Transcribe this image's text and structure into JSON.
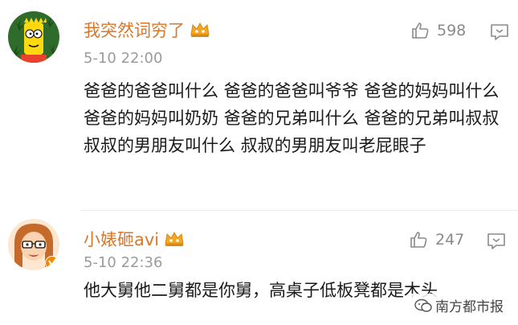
{
  "comments": [
    {
      "username": "我突然词穷了",
      "timestamp": "5-10 22:00",
      "likes": "598",
      "text": "爸爸的爸爸叫什么 爸爸的爸爸叫爷爷 爸爸的妈妈叫什么 爸爸的妈妈叫奶奶 爸爸的兄弟叫什么 爸爸的兄弟叫叔叔 叔叔的男朋友叫什么 叔叔的男朋友叫老屁眼子",
      "avatar_icon": "cartoon-avatar-icon",
      "badge_icon": "vip-crown-icon"
    },
    {
      "username": "小婊砸avi",
      "timestamp": "5-10 22:36",
      "likes": "247",
      "text": "他大舅他二舅都是你舅，高桌子低板凳都是木头",
      "avatar_icon": "cartoon-avatar-icon",
      "badge_icon": "vip-crown-icon"
    }
  ],
  "watermark": {
    "text": "南方都市报"
  },
  "colors": {
    "username": "#d9772b",
    "timestamp": "#9b9b9b",
    "text": "#1a1a1a",
    "icons": "#8a8a8a",
    "verified_badge": "#f08a00"
  }
}
